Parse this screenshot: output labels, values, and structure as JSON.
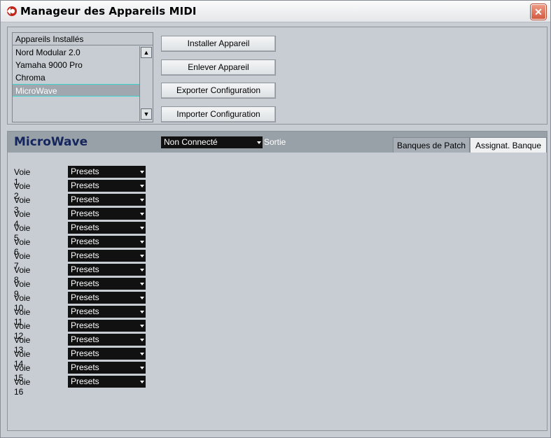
{
  "window": {
    "title": "Manageur des Appareils MIDI",
    "close": "✕"
  },
  "installed": {
    "header": "Appareils Installés",
    "items": [
      "Nord Modular 2.0",
      "Yamaha 9000 Pro",
      "Chroma",
      "MicroWave"
    ],
    "selected_index": 3
  },
  "buttons": {
    "install": "Installer Appareil",
    "remove": "Enlever Appareil",
    "export": "Exporter Configuration",
    "import": "Importer Configuration"
  },
  "device": {
    "name": "MicroWave",
    "output_value": "Non Connecté",
    "output_label": "Sortie",
    "tabs": [
      "Banques de Patch",
      "Assignat. Banque"
    ],
    "active_tab_index": 1
  },
  "voices": [
    {
      "label": "Voie 1",
      "value": "Presets"
    },
    {
      "label": "Voie 2",
      "value": "Presets"
    },
    {
      "label": "Voie 3",
      "value": "Presets"
    },
    {
      "label": "Voie 4",
      "value": "Presets"
    },
    {
      "label": "Voie 5",
      "value": "Presets"
    },
    {
      "label": "Voie 6",
      "value": "Presets"
    },
    {
      "label": "Voie 7",
      "value": "Presets"
    },
    {
      "label": "Voie 8",
      "value": "Presets"
    },
    {
      "label": "Voie 9",
      "value": "Presets"
    },
    {
      "label": "Voie 10",
      "value": "Presets"
    },
    {
      "label": "Voie 11",
      "value": "Presets"
    },
    {
      "label": "Voie 12",
      "value": "Presets"
    },
    {
      "label": "Voie 13",
      "value": "Presets"
    },
    {
      "label": "Voie 14",
      "value": "Presets"
    },
    {
      "label": "Voie 15",
      "value": "Presets"
    },
    {
      "label": "Voie 16",
      "value": "Presets"
    }
  ],
  "colors": {
    "panel": "#c7cdd3",
    "header": "#98a0a8",
    "device_name": "#14265c",
    "select_bg": "#111111",
    "selection_accent": "#3fd5cf",
    "close_button": "#d25b40"
  }
}
